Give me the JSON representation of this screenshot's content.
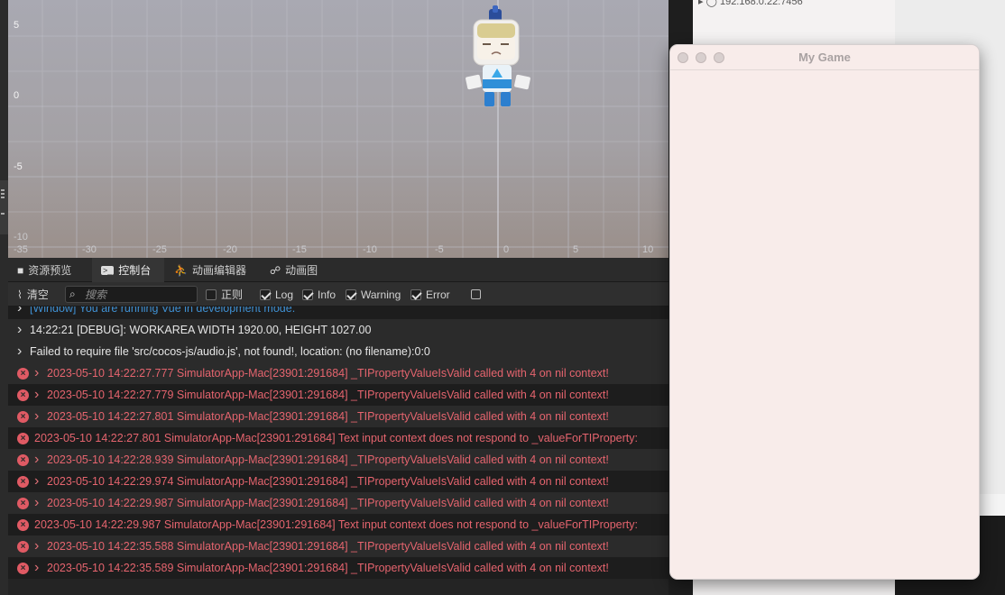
{
  "scene": {
    "y_ticks": [
      "5",
      "0",
      "-5",
      "-10"
    ],
    "x_ticks": [
      "-35",
      "-30",
      "-25",
      "-20",
      "-15",
      "-10",
      "-5",
      "0",
      "5",
      "10"
    ]
  },
  "hierarchy": {
    "row_label": "192.168.0.22:7456"
  },
  "game_window": {
    "title": "My Game"
  },
  "bottom_tabs": [
    {
      "label": "资源预览",
      "icon": "folder-icon"
    },
    {
      "label": "控制台",
      "icon": "terminal-icon"
    },
    {
      "label": "动画编辑器",
      "icon": "running-figure-icon"
    },
    {
      "label": "动画图",
      "icon": "animation-graph-icon"
    }
  ],
  "toolbar": {
    "clear_label": "清空",
    "search_placeholder": "搜索",
    "filters": [
      {
        "label": "正则",
        "checked": false
      },
      {
        "label": "Log",
        "checked": true
      },
      {
        "label": "Info",
        "checked": true
      },
      {
        "label": "Warning",
        "checked": true
      },
      {
        "label": "Error",
        "checked": true
      }
    ]
  },
  "logs": [
    {
      "text": "[Window] You are running Vue in development mode.",
      "level": "info",
      "chevron": true
    },
    {
      "text": "14:22:21 [DEBUG]: WORKAREA WIDTH 1920.00, HEIGHT 1027.00",
      "level": "log",
      "chevron": true
    },
    {
      "text": "Failed to require file 'src/cocos-js/audio.js', not found!, location: (no filename):0:0",
      "level": "log",
      "chevron": true
    },
    {
      "text": "2023-05-10 14:22:27.777 SimulatorApp-Mac[23901:291684] _TIPropertyValueIsValid called with 4 on nil context!",
      "level": "error",
      "chevron": true
    },
    {
      "text": "2023-05-10 14:22:27.779 SimulatorApp-Mac[23901:291684] _TIPropertyValueIsValid called with 4 on nil context!",
      "level": "error",
      "chevron": true
    },
    {
      "text": "2023-05-10 14:22:27.801 SimulatorApp-Mac[23901:291684] _TIPropertyValueIsValid called with 4 on nil context!",
      "level": "error",
      "chevron": true
    },
    {
      "text": "2023-05-10 14:22:27.801 SimulatorApp-Mac[23901:291684] Text input context does not respond to _valueForTIProperty:",
      "level": "error",
      "chevron": false
    },
    {
      "text": "2023-05-10 14:22:28.939 SimulatorApp-Mac[23901:291684] _TIPropertyValueIsValid called with 4 on nil context!",
      "level": "error",
      "chevron": true
    },
    {
      "text": "2023-05-10 14:22:29.974 SimulatorApp-Mac[23901:291684] _TIPropertyValueIsValid called with 4 on nil context!",
      "level": "error",
      "chevron": true
    },
    {
      "text": "2023-05-10 14:22:29.987 SimulatorApp-Mac[23901:291684] _TIPropertyValueIsValid called with 4 on nil context!",
      "level": "error",
      "chevron": true
    },
    {
      "text": "2023-05-10 14:22:29.987 SimulatorApp-Mac[23901:291684] Text input context does not respond to _valueForTIProperty:",
      "level": "error",
      "chevron": false
    },
    {
      "text": "2023-05-10 14:22:35.588 SimulatorApp-Mac[23901:291684] _TIPropertyValueIsValid called with 4 on nil context!",
      "level": "error",
      "chevron": true
    },
    {
      "text": "2023-05-10 14:22:35.589 SimulatorApp-Mac[23901:291684] _TIPropertyValueIsValid called with 4 on nil context!",
      "level": "error",
      "chevron": true
    }
  ],
  "colors": {
    "error_text": "#e5646e",
    "info_text": "#3f8fd1",
    "log_text": "#e6e6e6"
  }
}
